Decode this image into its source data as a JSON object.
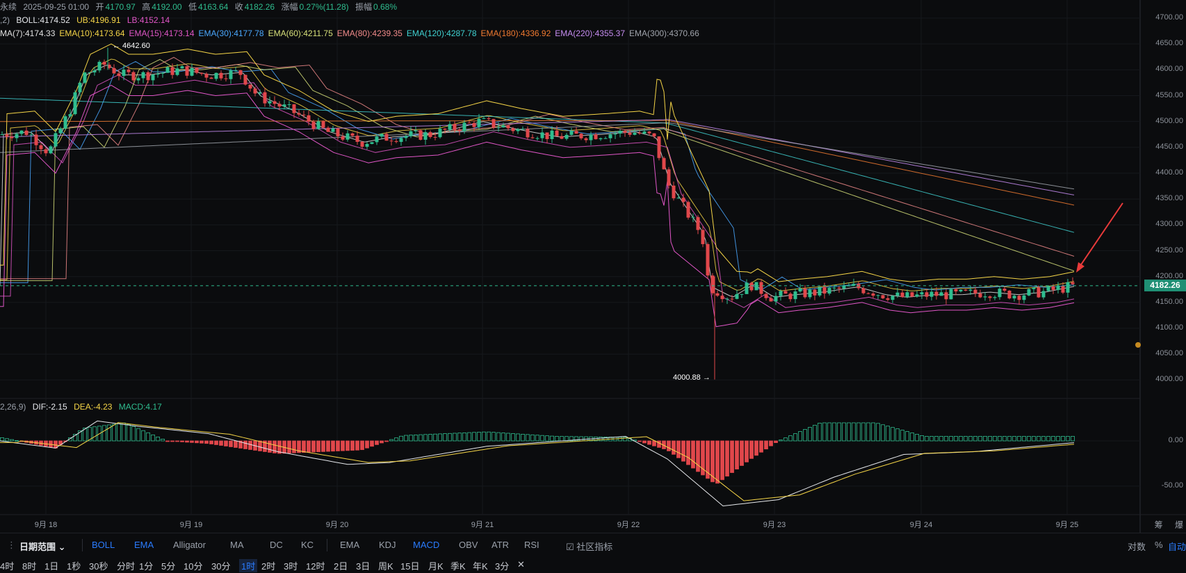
{
  "header": {
    "ohlc": {
      "symbol_fragment": "永续",
      "datetime": "2025-09-25 01:00",
      "open_label": "开",
      "open": "4170.97",
      "high_label": "高",
      "high": "4192.00",
      "low_label": "低",
      "low": "4163.64",
      "close_label": "收",
      "close": "4182.26",
      "change_label": "涨幅",
      "change": "0.27%(11.28)",
      "amplitude_label": "振幅",
      "amplitude": "0.68%"
    },
    "boll": {
      "params_fragment": ",2)",
      "boll": "BOLL:4174.52",
      "ub": "UB:4196.91",
      "lb": "LB:4152.14"
    },
    "ema": [
      {
        "text": "MA(7):4174.33",
        "color": "#e0e0e0"
      },
      {
        "text": "EMA(10):4173.64",
        "color": "#f5d547"
      },
      {
        "text": "EMA(15):4173.14",
        "color": "#e056c7"
      },
      {
        "text": "EMA(30):4177.78",
        "color": "#4aa8ff"
      },
      {
        "text": "EMA(60):4211.75",
        "color": "#d7e07a"
      },
      {
        "text": "EMA(80):4239.35",
        "color": "#f08a8a"
      },
      {
        "text": "EMA(120):4287.78",
        "color": "#3fd0d0"
      },
      {
        "text": "EMA(180):4336.92",
        "color": "#f07a30"
      },
      {
        "text": "EMA(220):4355.37",
        "color": "#c58cf0"
      },
      {
        "text": "EMA(300):4370.66",
        "color": "#a0a4ac"
      }
    ],
    "macd": {
      "params_fragment": "2,26,9)",
      "dif": "DIF:-2.15",
      "dea": "DEA:-4.23",
      "macd": "MACD:4.17"
    }
  },
  "price_axis": [
    "4700.00",
    "4650.00",
    "4600.00",
    "4550.00",
    "4500.00",
    "4450.00",
    "4400.00",
    "4350.00",
    "4300.00",
    "4250.00",
    "4200.00",
    "4150.00",
    "4100.00",
    "4050.00",
    "4000.00"
  ],
  "macd_axis": [
    "0.00",
    "-50.00"
  ],
  "current_price": "4182.26",
  "high_marker": "← 4642.60",
  "low_marker": "4000.88 →",
  "x_axis": [
    "9月 18",
    "9月 19",
    "9月 20",
    "9月 21",
    "9月 22",
    "9月 23",
    "9月 24",
    "9月 25"
  ],
  "corner": {
    "left": "筹",
    "right": "爆"
  },
  "toolbar": {
    "date_range": "日期范围",
    "main_indicators": [
      "BOLL",
      "EMA",
      "Alligator",
      "MA",
      "DC",
      "KC"
    ],
    "sub_indicators": [
      "EMA",
      "KDJ",
      "MACD",
      "OBV",
      "ATR",
      "RSI"
    ],
    "community": "社区指标",
    "scale_options": [
      "对数",
      "%",
      "自动"
    ]
  },
  "intervals": [
    "4时",
    "8时",
    "1日",
    "1秒",
    "30秒",
    "分时",
    "1分",
    "5分",
    "10分",
    "30分",
    "1时",
    "2时",
    "3时",
    "12时",
    "2日",
    "3日",
    "周K",
    "15日",
    "月K",
    "季K",
    "年K",
    "3分",
    "✕"
  ],
  "colors": {
    "up": "#2fbd8f",
    "down": "#e0474b",
    "accent": "#2a7cff",
    "price_tag": "#1f8f74"
  },
  "chart_data": {
    "type": "candlestick",
    "x": [
      "9月 18",
      "9月 19",
      "9月 20",
      "9月 21",
      "9月 22",
      "9月 23",
      "9月 24",
      "9月 25"
    ],
    "close": [
      4470,
      4590,
      4480,
      4485,
      4490,
      4170,
      4160,
      4182
    ],
    "ylim": [
      3990,
      4715
    ]
  }
}
